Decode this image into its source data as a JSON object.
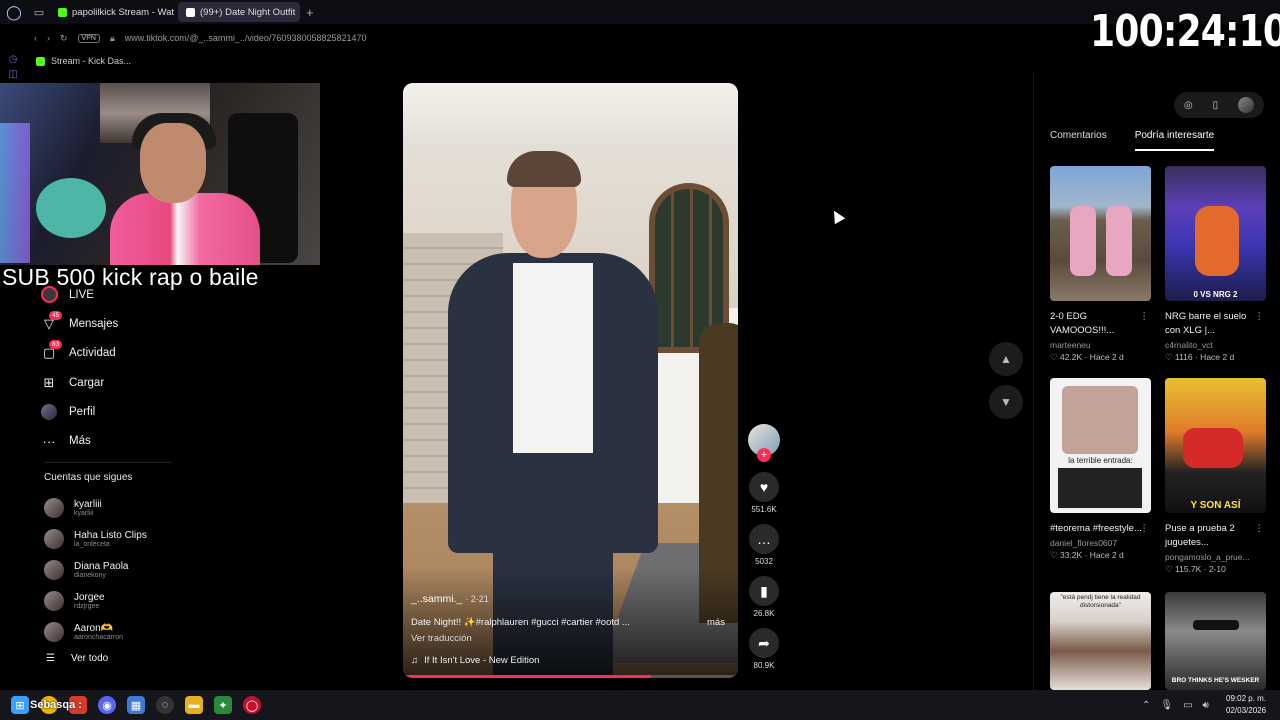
{
  "browser": {
    "tabs": [
      {
        "label": "papolilkick Stream - Watch",
        "fav_color": "#53fc18"
      },
      {
        "label": "(99+) Date Night Outfit",
        "fav_color": "#ffffff"
      }
    ],
    "vpn_label": "VPN",
    "url": "www.tiktok.com/@_..sammi_../video/7609380058825821470",
    "bookmark": "Stream - Kick Das..."
  },
  "overlay": {
    "sub_text": "SUB 500 kick  rap o  baile",
    "timer": "100:24:10"
  },
  "nav": {
    "items": [
      {
        "label": "LIVE",
        "icon": "live-icon",
        "badge": ""
      },
      {
        "label": "Mensajes",
        "icon": "message-icon",
        "badge": "45"
      },
      {
        "label": "Actividad",
        "icon": "activity-icon",
        "badge": "83"
      },
      {
        "label": "Cargar",
        "icon": "upload-icon",
        "badge": ""
      },
      {
        "label": "Perfil",
        "icon": "profile-icon",
        "badge": ""
      },
      {
        "label": "Más",
        "icon": "more-icon",
        "badge": ""
      }
    ]
  },
  "following": {
    "title": "Cuentas que sigues",
    "accounts": [
      {
        "name": "kyarliii",
        "handle": "kyarliii"
      },
      {
        "name": "Haha Listo Clips",
        "handle": "la_onleceta"
      },
      {
        "name": "Diana Paola",
        "handle": "dianekony"
      },
      {
        "name": "Jorgee",
        "handle": "rdzjrgee"
      },
      {
        "name": "Aaron🫶",
        "handle": "aaronchacarron"
      }
    ],
    "see_all": "Ver todo"
  },
  "video": {
    "username": "_..sammi._",
    "date": "· 2-21",
    "description": "Date Night!! ✨#ralphlauren #gucci #cartier #ootd ...",
    "more": "más",
    "translate": "Ver traducción",
    "music": "If It Isn't Love - New Edition",
    "progress_pct": 74
  },
  "actions": {
    "likes": "551.6K",
    "comments": "5032",
    "saves": "26.8K",
    "shares": "80.9K"
  },
  "right_panel": {
    "tabs": [
      "Comentarios",
      "Podría interesarte"
    ],
    "active_tab": 1,
    "cards": [
      {
        "title": "2-0 EDG VAMOOOS!!!...",
        "author": "marteeneu",
        "meta": "♡ 42.2K · Hace 2 d",
        "caption": ""
      },
      {
        "title": "NRG barre el suelo con XLG |...",
        "author": "c4rnalito_vct",
        "meta": "♡ 1116 · Hace 2 d",
        "caption": "0 VS NRG 2"
      },
      {
        "title": "#teorema #freestyle...",
        "author": "daniel_flores0607",
        "meta": "♡ 33.2K · Hace 2 d",
        "caption": "la terrible entrada:"
      },
      {
        "title": "Puse a prueba 2 juguetes...",
        "author": "pongamoslo_a_prue...",
        "meta": "♡ 115.7K · 2-10",
        "caption": "Y SON ASÍ"
      },
      {
        "title": "",
        "author": "",
        "meta": "",
        "caption": "\"está pendj tiene la realidad distorsionada\""
      },
      {
        "title": "",
        "author": "",
        "meta": "",
        "caption": "BRO THINKS HE'S WESKER"
      }
    ]
  },
  "taskbar": {
    "label": "Sebasqa :",
    "time": "09:02 p. m.",
    "date": "02/03/2026"
  },
  "colors": {
    "accent": "#fe2c55",
    "kick_green": "#53fc18"
  }
}
